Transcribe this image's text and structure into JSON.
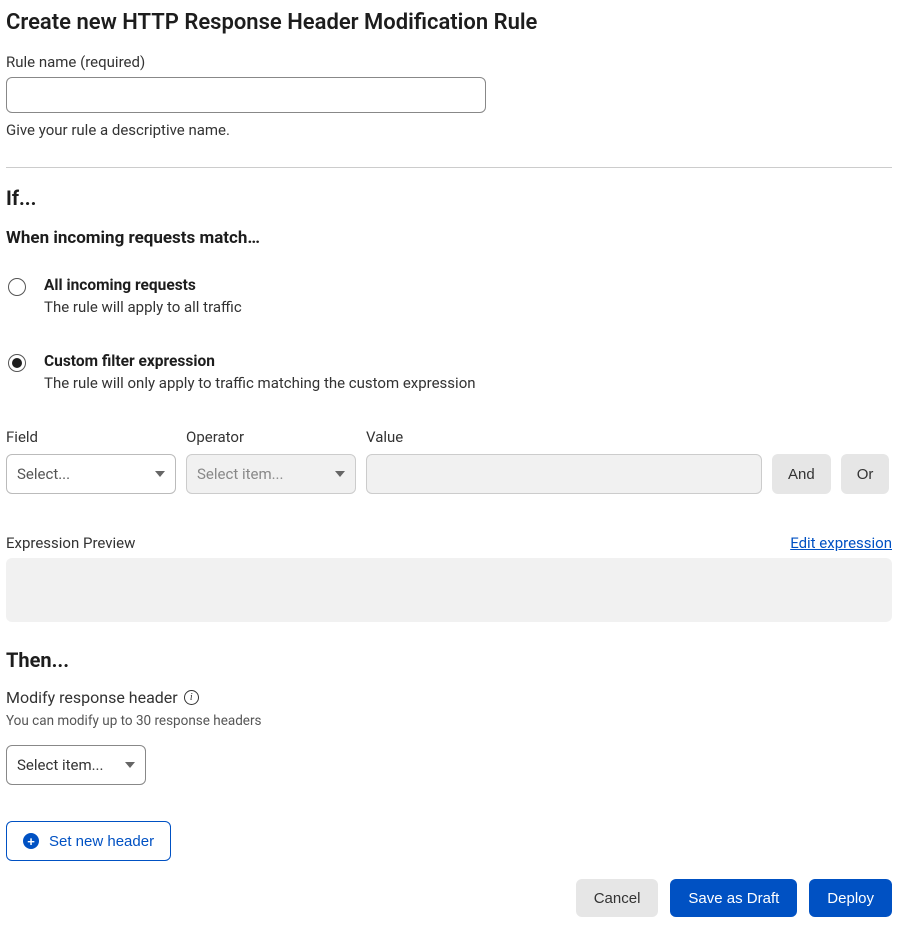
{
  "page_title": "Create new HTTP Response Header Modification Rule",
  "rule_name": {
    "label": "Rule name (required)",
    "value": "",
    "help": "Give your rule a descriptive name."
  },
  "if_section": {
    "title": "If...",
    "subtitle": "When incoming requests match…",
    "options": {
      "all": {
        "title": "All incoming requests",
        "desc": "The rule will apply to all traffic",
        "selected": false
      },
      "custom": {
        "title": "Custom filter expression",
        "desc": "The rule will only apply to traffic matching the custom expression",
        "selected": true
      }
    }
  },
  "filter": {
    "field_label": "Field",
    "field_placeholder": "Select...",
    "operator_label": "Operator",
    "operator_placeholder": "Select item...",
    "value_label": "Value",
    "value": "",
    "and_label": "And",
    "or_label": "Or"
  },
  "preview": {
    "label": "Expression Preview",
    "edit_link": "Edit expression"
  },
  "then_section": {
    "title": "Then...",
    "modify_label": "Modify response header",
    "modify_help": "You can modify up to 30 response headers",
    "select_placeholder": "Select item...",
    "set_new_label": "Set new header"
  },
  "actions": {
    "cancel": "Cancel",
    "save_draft": "Save as Draft",
    "deploy": "Deploy"
  }
}
